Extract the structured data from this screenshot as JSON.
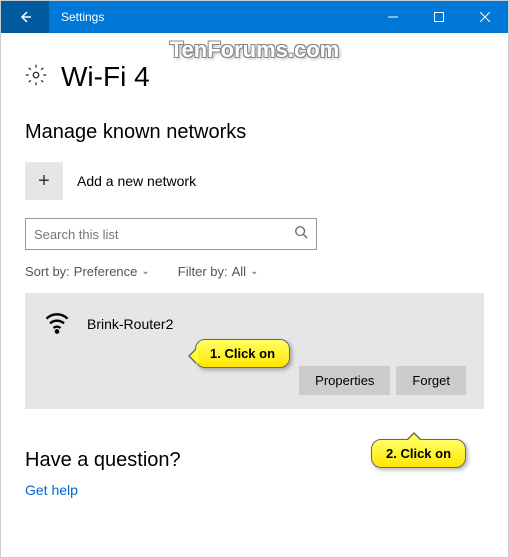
{
  "titlebar": {
    "title": "Settings"
  },
  "watermark": "TenForums.com",
  "header": {
    "title": "Wi-Fi 4"
  },
  "section": {
    "title": "Manage known networks"
  },
  "addNetwork": {
    "label": "Add a new network",
    "plus": "+"
  },
  "search": {
    "placeholder": "Search this list"
  },
  "filters": {
    "sortLabel": "Sort by:",
    "sortValue": "Preference",
    "filterLabel": "Filter by:",
    "filterValue": "All"
  },
  "network": {
    "name": "Brink-Router2",
    "propertiesBtn": "Properties",
    "forgetBtn": "Forget"
  },
  "callout1": "1. Click on",
  "callout2": "2. Click on",
  "question": {
    "title": "Have a question?",
    "link": "Get help"
  }
}
